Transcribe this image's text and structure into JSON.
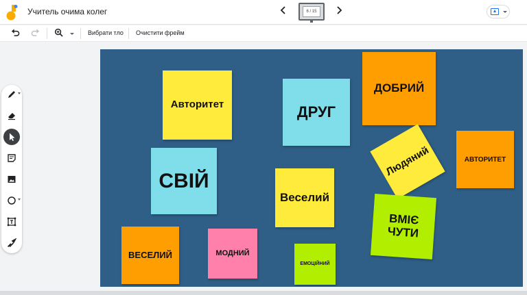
{
  "app": {
    "title": "Учитель очима колег",
    "frame_counter": "6 / 15"
  },
  "toolbar": {
    "set_background_label": "Вибрати тло",
    "clear_frame_label": "Очистити фрейм"
  },
  "notes": [
    {
      "text": "Авторитет",
      "color": "#ffeb3b"
    },
    {
      "text": "ДРУГ",
      "color": "#80deea"
    },
    {
      "text": "ДОБРИЙ",
      "color": "#ff9e00"
    },
    {
      "text": "СВІЙ",
      "color": "#80deea"
    },
    {
      "text": "Людяний",
      "color": "#ffeb3b"
    },
    {
      "text": "АВТОРИТЕТ",
      "color": "#ff9e00"
    },
    {
      "text": "Веселий",
      "color": "#ffeb3b"
    },
    {
      "text": "ВМІЄ ЧУТИ",
      "color": "#b2ee00"
    },
    {
      "text": "ВЕСЕЛИЙ",
      "color": "#ff9e00"
    },
    {
      "text": "МОДНИЙ",
      "color": "#ff80ab"
    },
    {
      "text": "ЕМОЦІЙНИЙ",
      "color": "#b2ee00"
    }
  ],
  "colors": {
    "board_background": "#2f5f86",
    "accent": "#1a73e8",
    "logo": "#f9ab00"
  },
  "icons": {
    "logo": "jamboard-logo-icon",
    "prev": "chevron-left-icon",
    "next": "chevron-right-icon",
    "share": "cast-upload-icon",
    "undo": "undo-icon",
    "redo": "redo-icon",
    "zoom": "zoom-in-icon",
    "tools": [
      "pen-icon",
      "eraser-icon",
      "select-arrow-icon",
      "sticky-note-icon",
      "image-icon",
      "circle-shape-icon",
      "text-box-icon",
      "laser-icon"
    ]
  }
}
